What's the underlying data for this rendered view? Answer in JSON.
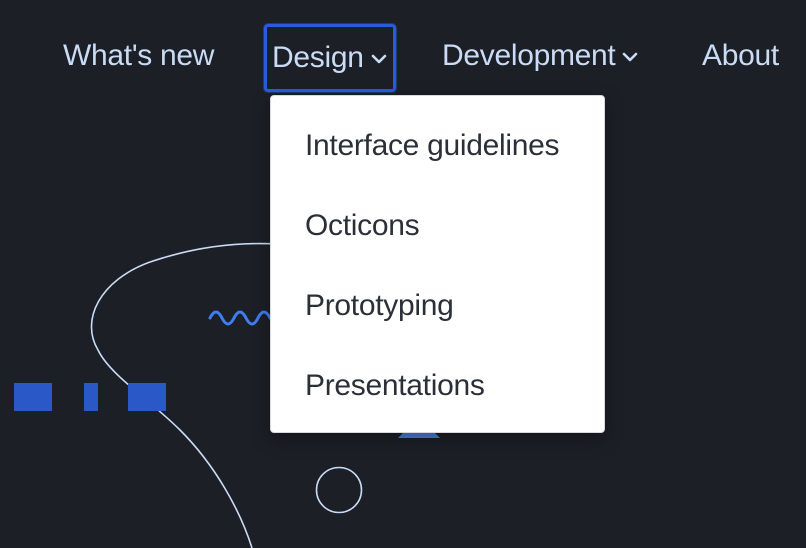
{
  "nav": {
    "items": [
      {
        "label": "What's new"
      },
      {
        "label": "Design",
        "has_dropdown": true,
        "chevron_icon": "chevron-down-icon",
        "state": "focused"
      },
      {
        "label": "Development",
        "has_dropdown": true,
        "chevron_icon": "chevron-down-icon"
      },
      {
        "label": "About"
      }
    ]
  },
  "dropdown": {
    "items": [
      {
        "label": "Interface guidelines"
      },
      {
        "label": "Octicons"
      },
      {
        "label": "Prototyping"
      },
      {
        "label": "Presentations"
      }
    ]
  },
  "colors": {
    "background": "#1c1f26",
    "nav_text": "#c9dbf5",
    "focus_ring": "#2a5ae0",
    "dropdown_bg": "#ffffff",
    "dropdown_text": "#2b3038",
    "accent_blue": "#2f63d6",
    "line_art": "#c9dbf5"
  }
}
